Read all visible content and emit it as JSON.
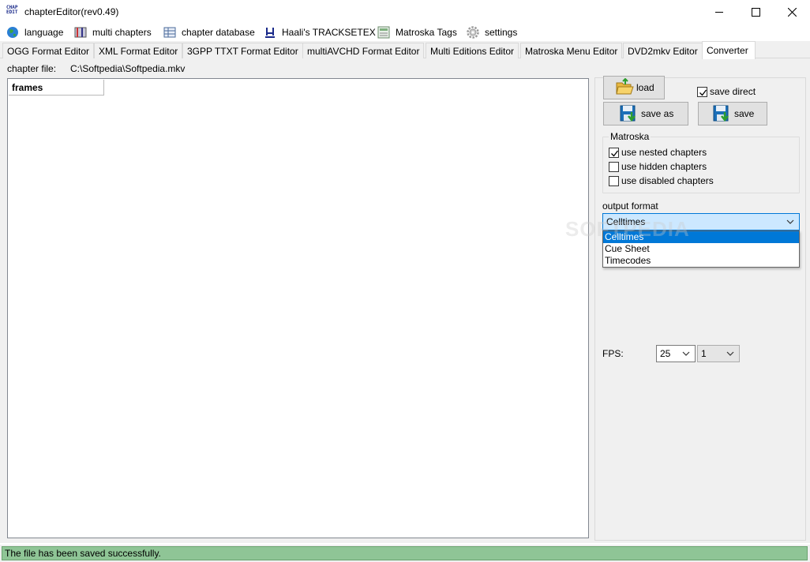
{
  "window": {
    "title": "chapterEditor(rev0.49)",
    "app_icon_text": "CHAP EDIT"
  },
  "menu": [
    {
      "label": "language",
      "icon": "globe-icon"
    },
    {
      "label": "multi chapters",
      "icon": "book-icon"
    },
    {
      "label": "chapter database",
      "icon": "database-icon"
    },
    {
      "label": "Haali's TRACKSETEX",
      "icon": "haali-icon"
    },
    {
      "label": "Matroska Tags",
      "icon": "tags-icon"
    },
    {
      "label": "settings",
      "icon": "gear-icon"
    }
  ],
  "tabs": [
    {
      "label": "OGG Format Editor"
    },
    {
      "label": "XML Format Editor"
    },
    {
      "label": "3GPP TTXT Format Editor"
    },
    {
      "label": "multiAVCHD Format Editor"
    },
    {
      "label": "Multi Editions Editor"
    },
    {
      "label": "Matroska Menu Editor"
    },
    {
      "label": "DVD2mkv Editor"
    },
    {
      "label": "Converter",
      "active": true
    }
  ],
  "converter": {
    "chapter_file_label": "chapter file:",
    "chapter_file_path": "C:\\Softpedia\\Softpedia.mkv",
    "list_column": "frames",
    "load_label": "load",
    "save_as_label": "save as",
    "save_label": "save",
    "save_direct_label": "save direct",
    "save_direct_checked": true,
    "matroska_group": "Matroska",
    "options": [
      {
        "label": "use nested chapters",
        "checked": true
      },
      {
        "label": "use hidden chapters",
        "checked": false
      },
      {
        "label": "use disabled chapters",
        "checked": false
      }
    ],
    "output_format_label": "output format",
    "output_format_value": "Celltimes",
    "output_format_options": [
      "Celltimes",
      "Cue Sheet",
      "Timecodes"
    ],
    "fps_label": "FPS:",
    "fps_value": "25",
    "fps_divisor": "1"
  },
  "status": {
    "message": "The file has been saved successfully.",
    "color": "#8fc596"
  },
  "watermark": "SOFTPEDIA"
}
